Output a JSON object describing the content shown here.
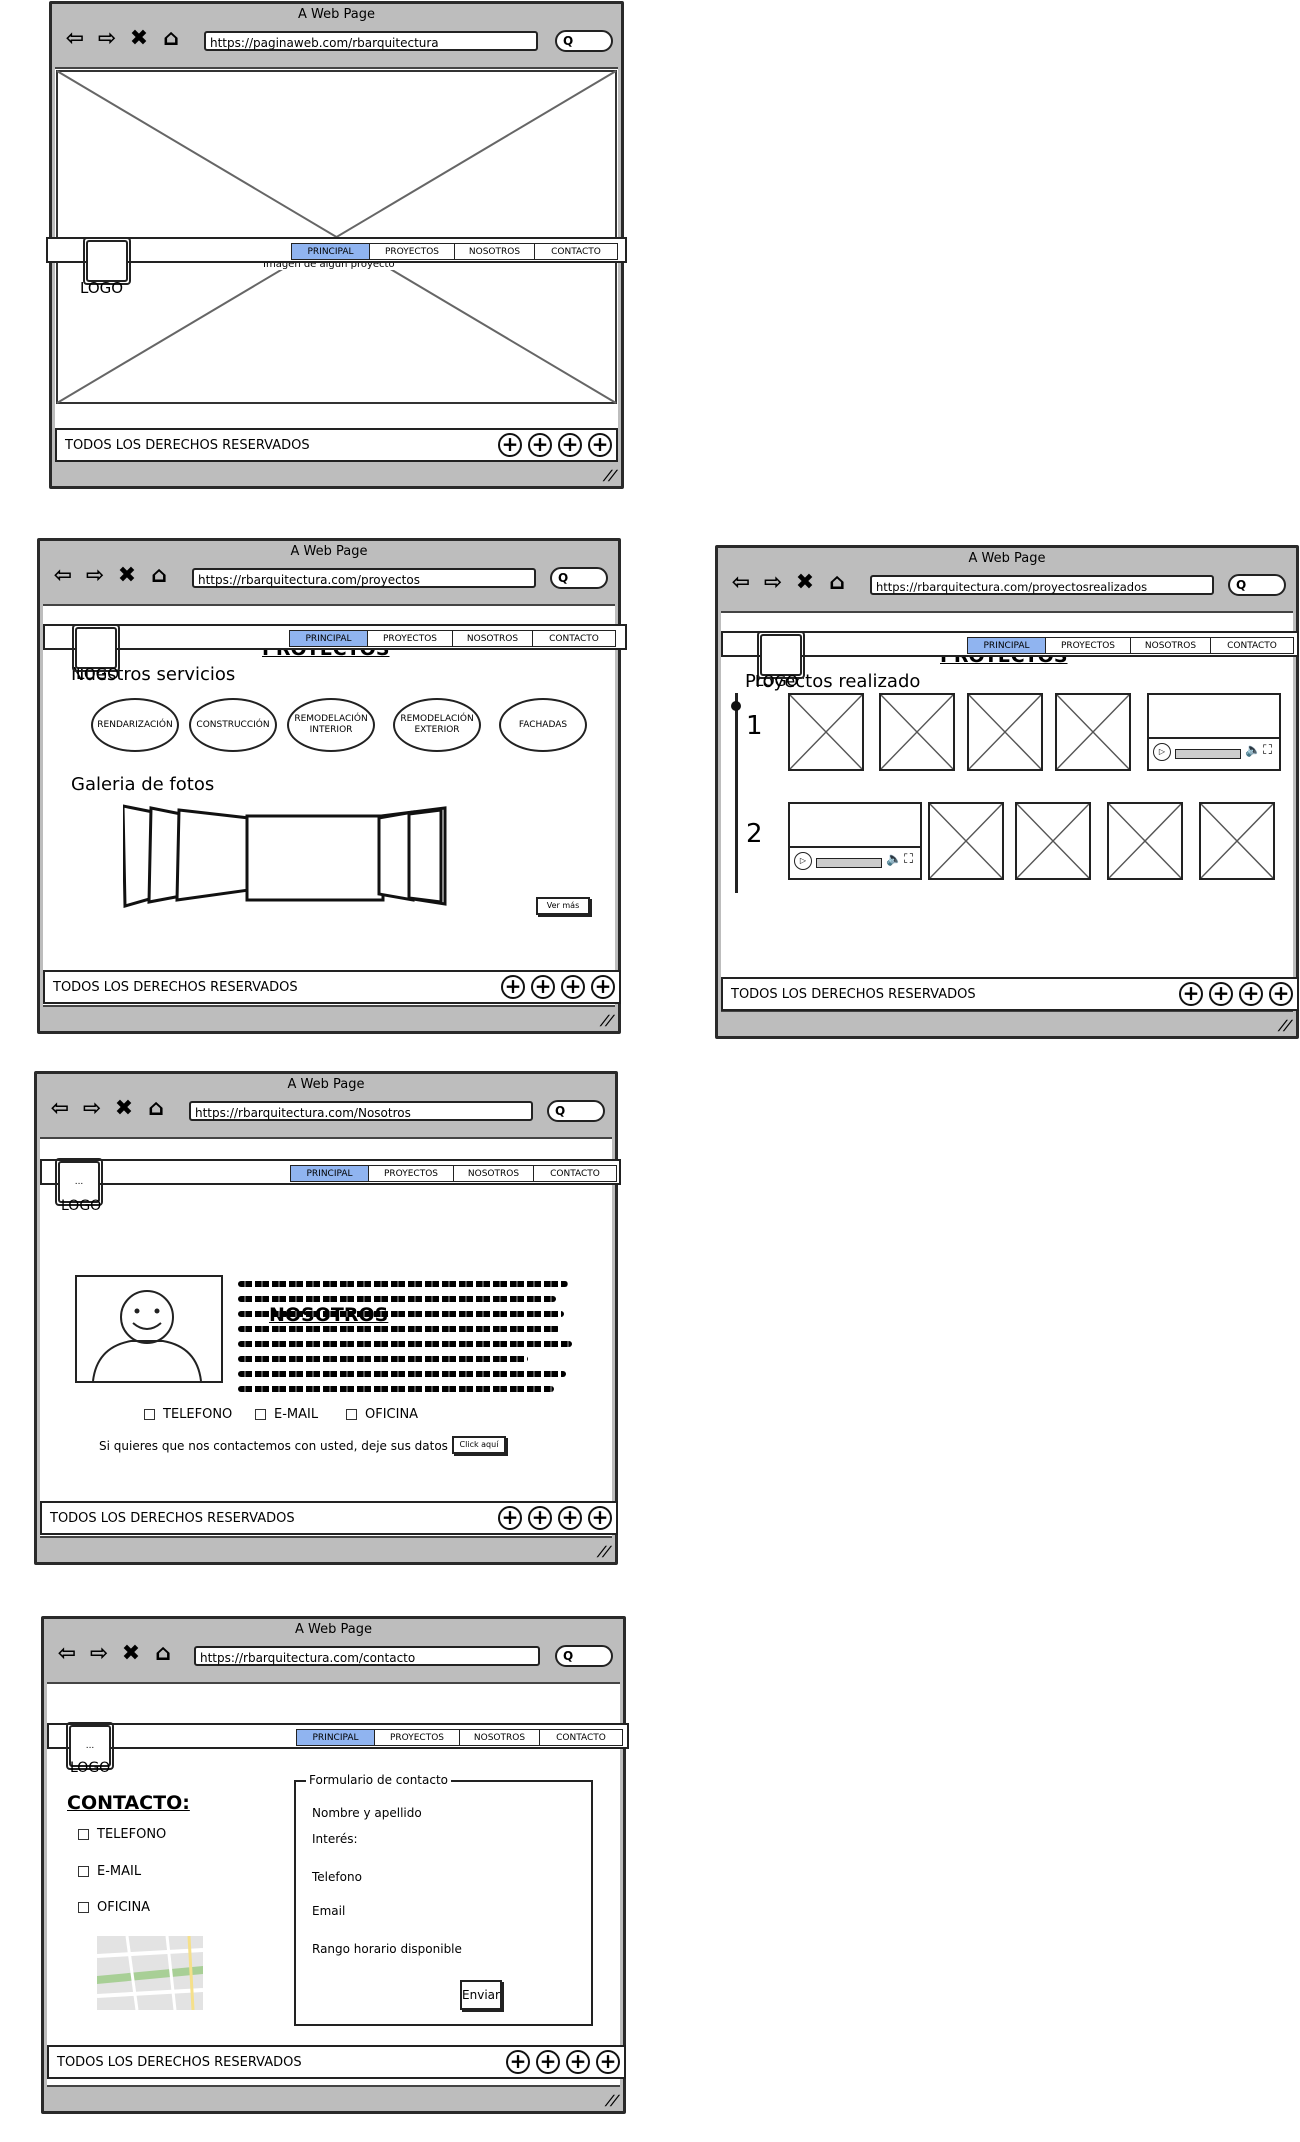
{
  "browser": {
    "title": "A Web Page",
    "nav_icons": [
      "back-arrow-icon",
      "forward-arrow-icon",
      "close-x-icon",
      "home-icon"
    ],
    "search_icon": "Q"
  },
  "menu": [
    "PRINCIPAL",
    "PROYECTOS",
    "NOSOTROS",
    "CONTACTO"
  ],
  "logo_label": "LOGO",
  "logo_placeholder": "...",
  "footer": {
    "text": "TODOS LOS DERECHOS RESERVADOS",
    "icons": [
      "plus-icon",
      "plus-icon",
      "plus-icon",
      "plus-icon"
    ]
  },
  "windows": {
    "principal": {
      "url": "https://paginaweb.com/rbarquitectura",
      "image_caption": "Imagen de algun proyecto"
    },
    "proyectos": {
      "url": "https://rbarquitectura.com/proyectos",
      "heading": "PROYECTOS",
      "services_title": "Nuestros servicios",
      "services": [
        "RENDARIZACIÓN",
        "CONSTRUCCIÓN",
        "REMODELACIÓN INTERIOR",
        "REMODELACIÓN EXTERIOR",
        "FACHADAS"
      ],
      "gallery_title": "Galeria de fotos",
      "more_button": "Ver más"
    },
    "realizados": {
      "url": "https://rbarquitectura.com/proyectosrealizados",
      "heading": "PROYECTOS",
      "subtitle": "Proyectos realizado",
      "row_labels": [
        "1",
        "2"
      ]
    },
    "nosotros": {
      "url": "https://rbarquitectura.com/Nosotros",
      "heading": "NOSOTROS",
      "contact_options": [
        "TELEFONO",
        "E-MAIL",
        "OFICINA"
      ],
      "cta_text": "Si quieres que nos contactemos con usted, deje sus datos",
      "cta_button": "Click aquí"
    },
    "contacto": {
      "url": "https://rbarquitectura.com/contacto",
      "heading": "CONTACTO:",
      "contact_options": [
        "TELEFONO",
        "E-MAIL",
        "OFICINA"
      ],
      "form_title": "Formulario de contacto",
      "form_fields": [
        "Nombre y apellido",
        "Interés:",
        "Telefono",
        "Email",
        "Rango horario disponible"
      ],
      "submit": "Enviar"
    }
  }
}
